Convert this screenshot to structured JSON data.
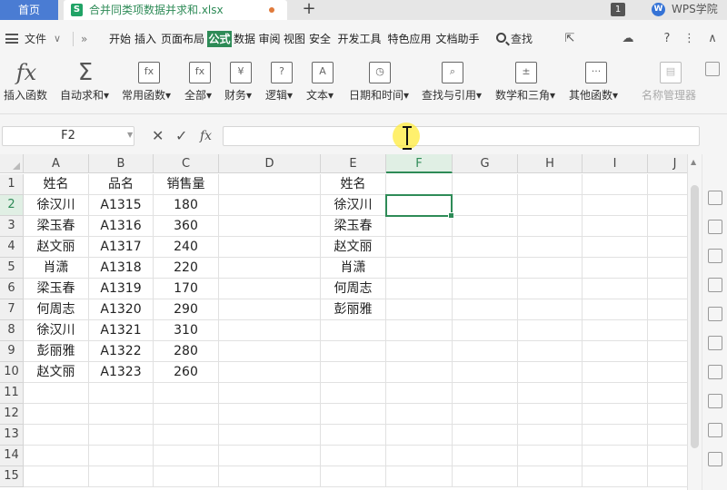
{
  "tabs": {
    "home": "首页",
    "file_icon": "S",
    "file_name": "合并同类项数据并求和.xlsx",
    "add": "+"
  },
  "window": {
    "count": "1",
    "brand_logo": "W",
    "brand": "WPS学院"
  },
  "menubar": {
    "file": "文件",
    "file_arrow": "∨",
    "more": "»",
    "items": [
      "开始",
      "插入",
      "页面布局",
      "公式",
      "数据",
      "审阅",
      "视图",
      "安全",
      "开发工具",
      "特色应用",
      "文档助手"
    ],
    "active": "公式",
    "search": "查找",
    "tools": [
      "share-icon",
      "cloud-icon",
      "help-icon",
      "more-icon",
      "collapse-icon"
    ],
    "tool_glyphs": [
      "⇱",
      "☁",
      "?",
      "⋮",
      "∧"
    ]
  },
  "ribbon": {
    "insert_fn": {
      "icon": "fx",
      "label": "插入函数"
    },
    "autosum": {
      "icon": "Σ",
      "label": "自动求和▾"
    },
    "common": {
      "icon": "fx",
      "label": "常用函数▾"
    },
    "all": {
      "icon": "fx",
      "label": "全部▾"
    },
    "finance": {
      "icon": "¥",
      "label": "财务▾"
    },
    "logic": {
      "icon": "?",
      "label": "逻辑▾"
    },
    "text": {
      "icon": "A",
      "label": "文本▾"
    },
    "datetime": {
      "icon": "◷",
      "label": "日期和时间▾"
    },
    "lookup": {
      "icon": "⌕",
      "label": "查找与引用▾"
    },
    "math": {
      "icon": "±",
      "label": "数学和三角▾"
    },
    "other": {
      "icon": "···",
      "label": "其他函数▾"
    },
    "name_mgr": {
      "icon": "▤",
      "label": "名称管理器"
    }
  },
  "formula_bar": {
    "name_box": "F2",
    "cancel": "✕",
    "confirm": "✓",
    "fx": "fx",
    "value": ""
  },
  "grid": {
    "selected_cell": "F2",
    "columns": [
      "A",
      "B",
      "C",
      "D",
      "E",
      "F",
      "G",
      "H",
      "I",
      "J"
    ],
    "rows": [
      "1",
      "2",
      "3",
      "4",
      "5",
      "6",
      "7",
      "8",
      "9",
      "10",
      "11",
      "12",
      "13",
      "14",
      "15"
    ],
    "cells": {
      "A1": "姓名",
      "B1": "品名",
      "C1": "销售量",
      "E1": "姓名",
      "A2": "徐汉川",
      "B2": "A1315",
      "C2": "180",
      "E2": "徐汉川",
      "A3": "梁玉春",
      "B3": "A1316",
      "C3": "360",
      "E3": "梁玉春",
      "A4": "赵文丽",
      "B4": "A1317",
      "C4": "240",
      "E4": "赵文丽",
      "A5": "肖潇",
      "B5": "A1318",
      "C5": "220",
      "E5": "肖潇",
      "A6": "梁玉春",
      "B6": "A1319",
      "C6": "170",
      "E6": "何周志",
      "A7": "何周志",
      "B7": "A1320",
      "C7": "290",
      "E7": "彭丽雅",
      "A8": "徐汉川",
      "B8": "A1321",
      "C8": "310",
      "A9": "彭丽雅",
      "B9": "A1322",
      "C9": "280",
      "A10": "赵文丽",
      "B10": "A1323",
      "C10": "260"
    }
  },
  "colors": {
    "accent": "#2e8b57",
    "home_tab": "#4a7cd3"
  }
}
